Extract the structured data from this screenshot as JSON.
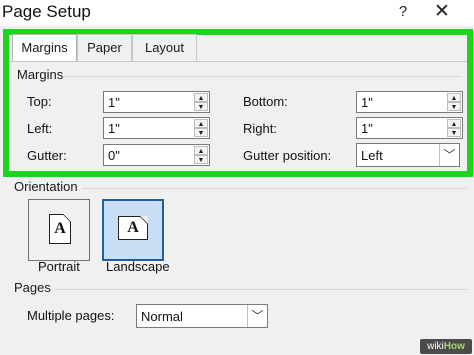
{
  "window": {
    "title": "Page Setup",
    "help_glyph": "?",
    "close_glyph": "✕"
  },
  "tabs": [
    {
      "label": "Margins",
      "active": true
    },
    {
      "label": "Paper",
      "active": false
    },
    {
      "label": "Layout",
      "active": false
    }
  ],
  "highlight_color": "#1ed51e",
  "margins": {
    "group_label": "Margins",
    "top": {
      "label": "Top:",
      "value": "1\""
    },
    "bottom": {
      "label": "Bottom:",
      "value": "1\""
    },
    "left": {
      "label": "Left:",
      "value": "1\""
    },
    "right": {
      "label": "Right:",
      "value": "1\""
    },
    "gutter": {
      "label": "Gutter:",
      "value": "0\""
    },
    "gutter_position": {
      "label": "Gutter position:",
      "value": "Left"
    }
  },
  "orientation": {
    "group_label": "Orientation",
    "portrait": {
      "label": "Portrait",
      "icon": "portrait-page-icon",
      "selected": false
    },
    "landscape": {
      "label": "Landscape",
      "icon": "landscape-page-icon",
      "selected": true
    },
    "glyph": "A"
  },
  "pages": {
    "group_label": "Pages",
    "multiple_pages": {
      "label": "Multiple pages:",
      "value": "Normal"
    }
  },
  "watermark": {
    "prefix": "wiki",
    "suffix": "How"
  }
}
